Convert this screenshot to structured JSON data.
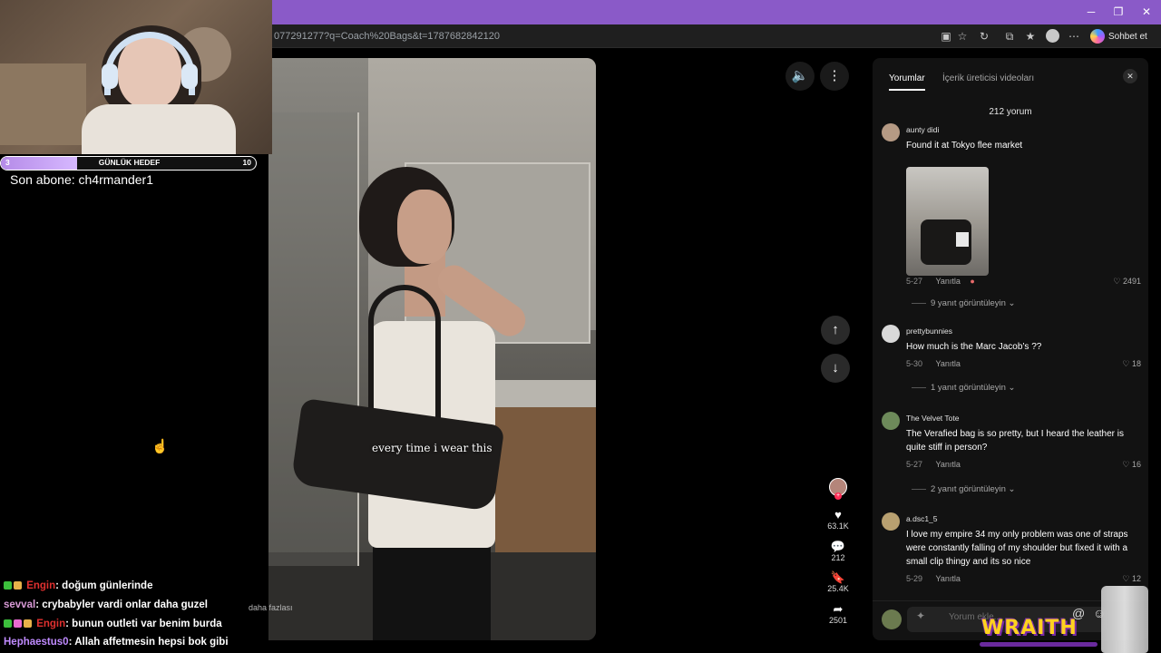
{
  "browser": {
    "url": "077291277?q=Coach%20Bags&t=1787682842120",
    "window_controls": {
      "minimize": "─",
      "restore": "❐",
      "close": "✕"
    },
    "copilot_label": "Sohbet et",
    "accent_color": "#8a5ac8"
  },
  "video": {
    "caption": "every time i wear this",
    "sound_icon": "speaker-icon",
    "more_icon": "more-vertical-icon",
    "nav_up_icon": "arrow-up-icon",
    "nav_down_icon": "arrow-down-icon",
    "actions": {
      "likes": "63.1K",
      "comments": "212",
      "saves": "25.4K",
      "shares": "2501"
    }
  },
  "comments_panel": {
    "tabs": [
      "Yorumlar",
      "İçerik üreticisi videoları"
    ],
    "count_label": "212 yorum",
    "reply_label": "Yanıtla",
    "input_placeholder": "Yorum ekle...",
    "comments": [
      {
        "user": "aunty didi",
        "text": "Found it at Tokyo flee market",
        "date": "5-27",
        "likes": "2491",
        "view_replies": "9 yanıt görüntüleyin",
        "avatar_color": "#b59a84"
      },
      {
        "user": "prettybunnies",
        "text": "How much is the Marc Jacob’s ??",
        "date": "5-30",
        "likes": "18",
        "view_replies": "1 yanıt görüntüleyin",
        "avatar_color": "#d9d9d9"
      },
      {
        "user": "The Velvet Tote",
        "text": "The Verafied bag is so pretty, but I heard the leather is quite stiff in person?",
        "date": "5-27",
        "likes": "16",
        "view_replies": "2 yanıt görüntüleyin",
        "avatar_color": "#6d8a5a"
      },
      {
        "user": "a.dsc1_5",
        "text": "I love my empire 34 my only problem was one of straps were constantly falling of my shoulder but fixed it with a small clip thingy and its so nice",
        "date": "5-29",
        "likes": "12",
        "avatar_color": "#b8a070"
      }
    ]
  },
  "stream": {
    "goal_label": "GÜNLÜK HEDEF",
    "goal_current": "3",
    "goal_max": "10",
    "goal_fraction": 0.3,
    "last_subscriber": "Son abone: ch4rmander1",
    "chat": [
      {
        "user": "Engin",
        "message": ": doğum günlerinde"
      },
      {
        "user": "sevval",
        "message": ": crybabyler vardi onlar daha guzel"
      },
      {
        "user": "Engin",
        "message": ": bunun outleti var benim burda"
      },
      {
        "user": "Hephaestus0",
        "message": ": Allah affetmesin hepsi bok gibi"
      }
    ],
    "ghost_more": "daha fazlası",
    "overlay_brand": "WRAITH"
  }
}
